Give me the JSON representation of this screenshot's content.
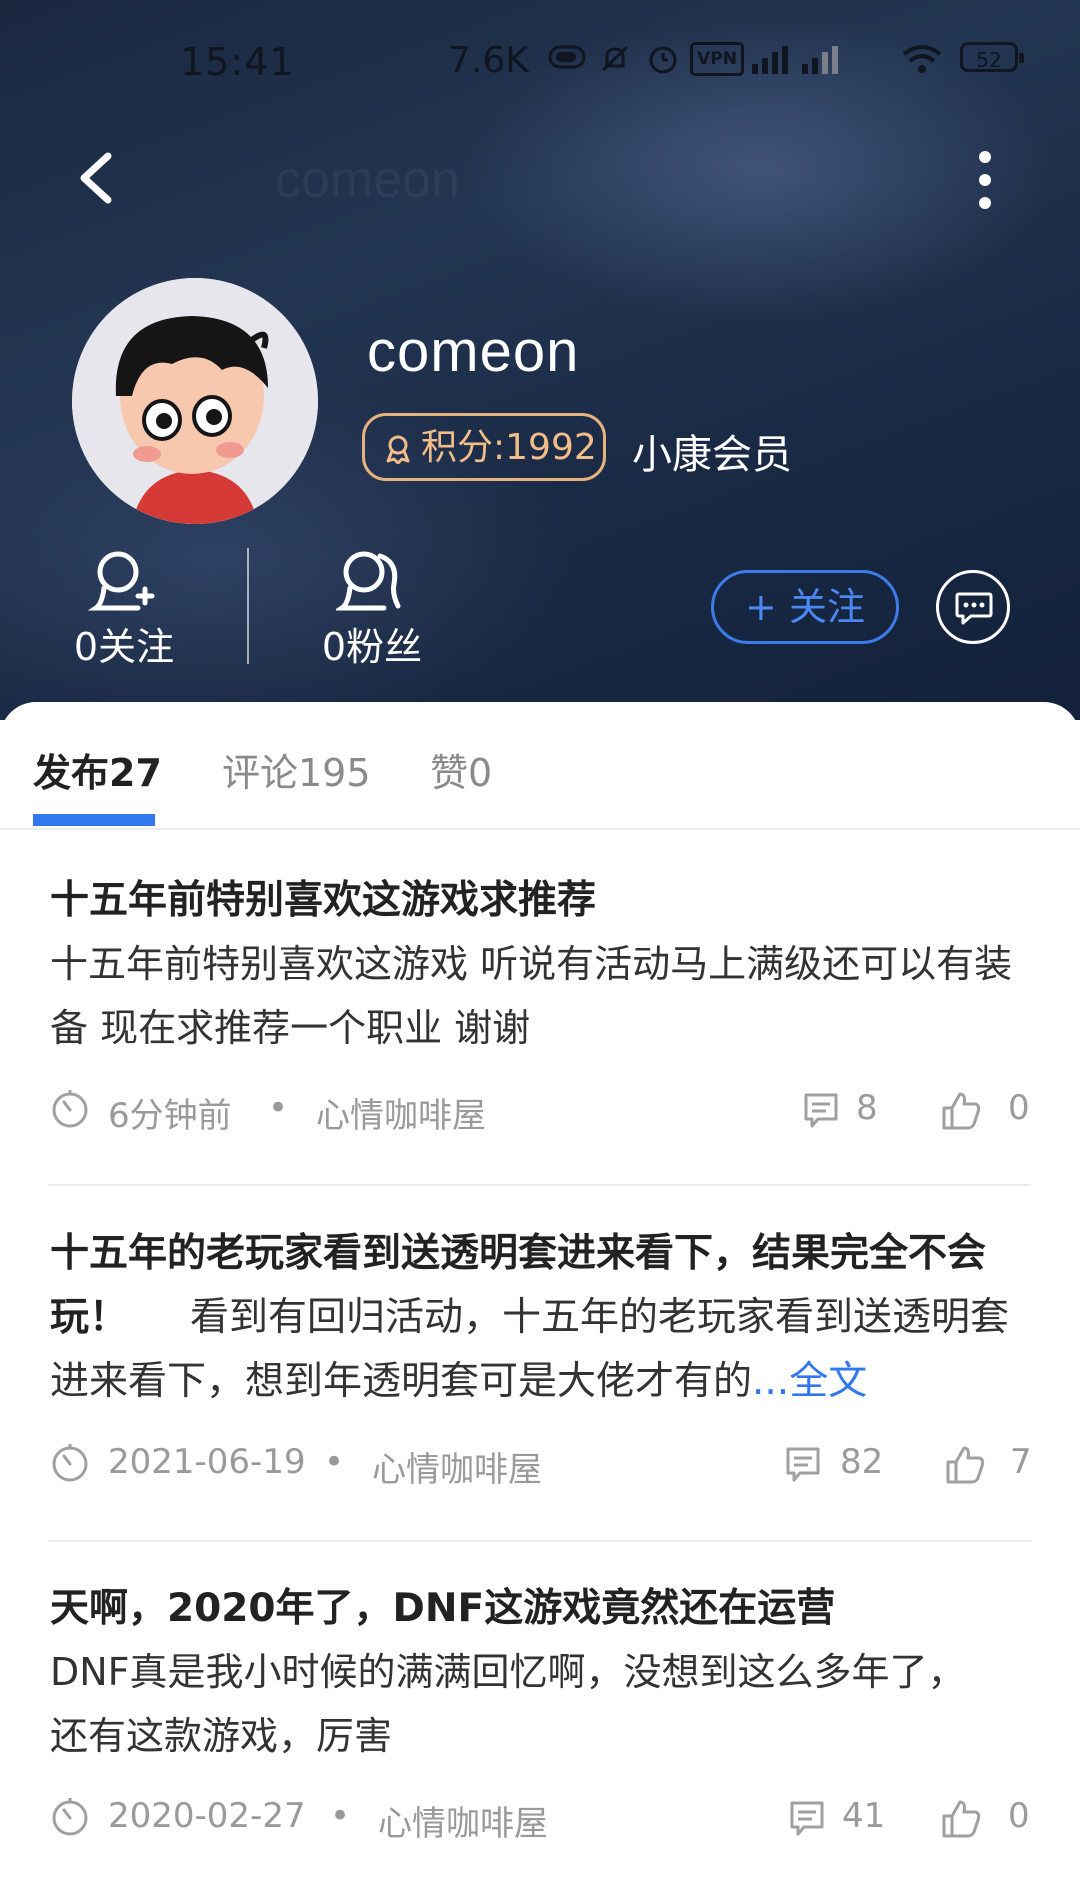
{
  "status_bar": {
    "time": "15:41",
    "net_speed": "7.6K",
    "vpn_label": "VPN",
    "battery": "52"
  },
  "nav": {
    "ghost_title": "comeon"
  },
  "profile": {
    "username": "comeon",
    "points_label": "积分:1992",
    "member_label": "小康会员",
    "following_label": "0关注",
    "followers_label": "0粉丝",
    "follow_button": "+ 关注"
  },
  "tabs": [
    {
      "label": "发布27",
      "active": true
    },
    {
      "label": "评论195",
      "active": false
    },
    {
      "label": "赞0",
      "active": false
    }
  ],
  "posts": [
    {
      "title": "十五年前特别喜欢这游戏求推荐",
      "body": "十五年前特别喜欢这游戏 听说有活动马上满级还可以有装备 现在求推荐一个职业 谢谢",
      "time": "6分钟前",
      "category": "心情咖啡屋",
      "comments": "8",
      "likes": "0"
    },
    {
      "title": "十五年的老玩家看到送透明套进来看下，结果完全不会玩！",
      "body": "看到有回归活动，十五年的老玩家看到送透明套进来看下，想到年透明套可是大佬才有的",
      "more_label": "...全文",
      "time": "2021-06-19",
      "category": "心情咖啡屋",
      "comments": "82",
      "likes": "7"
    },
    {
      "title": "天啊，2020年了，DNF这游戏竟然还在运营",
      "body": "DNF真是我小时候的满满回忆啊，没想到这么多年了，还有这款游戏，厉害",
      "time": "2020-02-27",
      "category": "心情咖啡屋",
      "comments": "41",
      "likes": "0"
    }
  ],
  "meta_separator": "•",
  "colors": {
    "accent": "#3377ee",
    "points_gold": "#f2bd88",
    "header_bg": "#1e3050"
  }
}
